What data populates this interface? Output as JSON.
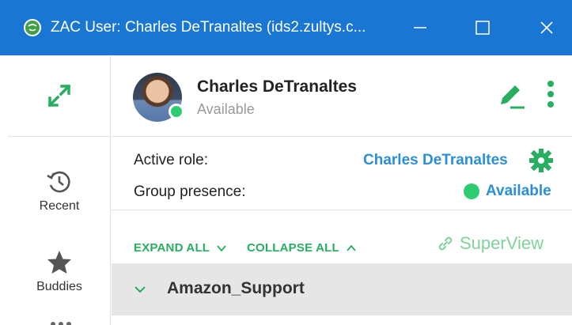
{
  "window": {
    "title": "ZAC User: Charles DeTranaltes (ids2.zultys.c...",
    "app_icon": "zac-logo-icon",
    "controls": [
      "minimize-icon",
      "maximize-icon",
      "close-icon"
    ]
  },
  "rail": {
    "top_icon": "expand-arrows-icon",
    "items": [
      {
        "label": "Recent",
        "icon": "history-clock-icon"
      },
      {
        "label": "Buddies",
        "icon": "star-icon"
      }
    ],
    "more_icon": "more-dots-icon"
  },
  "profile": {
    "name": "Charles DeTranaltes",
    "status": "Available",
    "status_color": "#2ecc71",
    "edit_icon": "edit-pencil-icon",
    "menu_icon": "vertical-dots-icon"
  },
  "roles": {
    "active_role_label": "Active role:",
    "active_role_value": "Charles DeTranaltes",
    "gear_icon": "gear-icon",
    "group_presence_label": "Group presence:",
    "group_presence_value": "Available"
  },
  "controls": {
    "expand_all": "EXPAND ALL",
    "collapse_all": "COLLAPSE ALL",
    "superview": "SuperView"
  },
  "groups": [
    {
      "name": "Amazon_Support",
      "expanded": false
    }
  ],
  "colors": {
    "titlebar": "#1976d2",
    "accent_green": "#27ae60",
    "link_blue": "#2b8fd6",
    "group_bg": "#e6e6e6"
  }
}
